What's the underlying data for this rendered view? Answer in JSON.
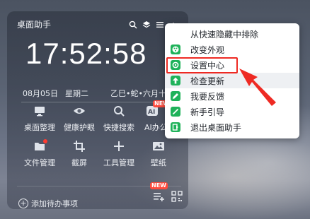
{
  "widget": {
    "title": "桌面助手",
    "time": "17:52:58",
    "time_cut": "0",
    "date": "08月05日",
    "weekday": "星期二",
    "lunar": "乙巳•蛇•六月十",
    "tools": [
      {
        "label": "桌面整理",
        "icon": "monitor-icon"
      },
      {
        "label": "健康护眼",
        "icon": "eye-icon"
      },
      {
        "label": "快捷搜索",
        "icon": "search-icon"
      },
      {
        "label": "AI办公",
        "icon": "ai-icon"
      },
      {
        "label": "文件管理",
        "icon": "folder-icon"
      },
      {
        "label": "截屏",
        "icon": "crop-icon"
      },
      {
        "label": "工具管理",
        "icon": "plus-icon"
      },
      {
        "label": "壁纸",
        "icon": "image-icon"
      }
    ],
    "todo_label": "添加待办事项",
    "new_badge": "NEW",
    "ai_badge": "NEW"
  },
  "menu": {
    "items": [
      {
        "label": "从快速隐藏中排除",
        "icon": ""
      },
      {
        "label": "改变外观",
        "icon": "palette-icon"
      },
      {
        "label": "设置中心",
        "icon": "gear-icon"
      },
      {
        "label": "检查更新",
        "icon": "arrow-up-icon"
      },
      {
        "label": "我要反馈",
        "icon": "pencil-icon"
      },
      {
        "label": "新手引导",
        "icon": "pen-icon"
      },
      {
        "label": "退出桌面助手",
        "icon": "exit-icon"
      }
    ],
    "highlighted": "设置中心"
  },
  "colors": {
    "accent_green": "#1fb25a",
    "annotation_red": "#ee2a23"
  }
}
